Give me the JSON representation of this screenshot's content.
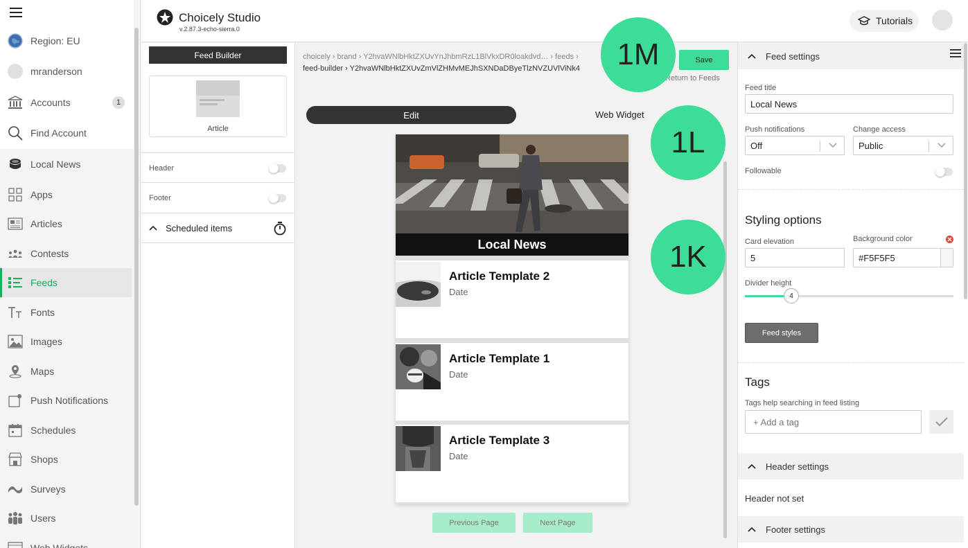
{
  "app": {
    "name": "Choicely Studio",
    "version": "v.2.87.3-echo-sierra.0"
  },
  "header": {
    "tutorials_label": "Tutorials"
  },
  "nav": {
    "region": "Region: EU",
    "user": "mranderson",
    "accounts": "Accounts",
    "accounts_count": "1",
    "find_account": "Find Account",
    "current_app": "Local News",
    "items": [
      "Apps",
      "Articles",
      "Contests",
      "Feeds",
      "Fonts",
      "Images",
      "Maps",
      "Push Notifications",
      "Schedules",
      "Shops",
      "Surveys",
      "Users",
      "Web Widgets"
    ],
    "active_item": "Feeds"
  },
  "feed_builder": {
    "button_label": "Feed Builder",
    "article_label": "Article",
    "header_label": "Header",
    "footer_label": "Footer",
    "scheduled_label": "Scheduled items"
  },
  "breadcrumb": {
    "row1": "choicely › brand › Y2hvaWNlbHktZXUvYnJhbmRzL1BlVkxDR0loakdvd… › feeds ›",
    "row2": "feed-builder › Y2hvaWNlbHktZXUvZmVlZHMvMEJhSXNDaDByeTlzNVZUVlViNk4"
  },
  "actions": {
    "save": "Save",
    "return": "Return to Feeds"
  },
  "tabs": {
    "edit": "Edit",
    "web_widget": "Web Widget"
  },
  "preview": {
    "hero_title": "Local News",
    "cards": [
      {
        "title": "Article Template 2",
        "date": "Date"
      },
      {
        "title": "Article Template 1",
        "date": "Date"
      },
      {
        "title": "Article Template 3",
        "date": "Date"
      }
    ],
    "prev_page": "Previous Page",
    "next_page": "Next Page"
  },
  "annotations": [
    "1M",
    "1L",
    "1K"
  ],
  "settings": {
    "feed_settings_title": "Feed settings",
    "feed_title_label": "Feed title",
    "feed_title_value": "Local News",
    "push_label": "Push notifications",
    "push_value": "Off",
    "access_label": "Change access",
    "access_value": "Public",
    "followable_label": "Followable",
    "styling_title": "Styling options",
    "card_elevation_label": "Card elevation",
    "card_elevation_value": "5",
    "bg_color_label": "Background color",
    "bg_color_value": "#F5F5F5",
    "divider_label": "Divider height",
    "divider_value": "4",
    "feed_styles_label": "Feed styles",
    "tags_title": "Tags",
    "tags_help": "Tags help searching in feed listing",
    "tags_placeholder": "+ Add a tag",
    "header_settings_title": "Header settings",
    "header_not_set": "Header not set",
    "footer_settings_title": "Footer settings"
  },
  "colors": {
    "accent": "#3ddc97",
    "active_nav": "#1aaf5d",
    "dark_button": "#333333"
  }
}
